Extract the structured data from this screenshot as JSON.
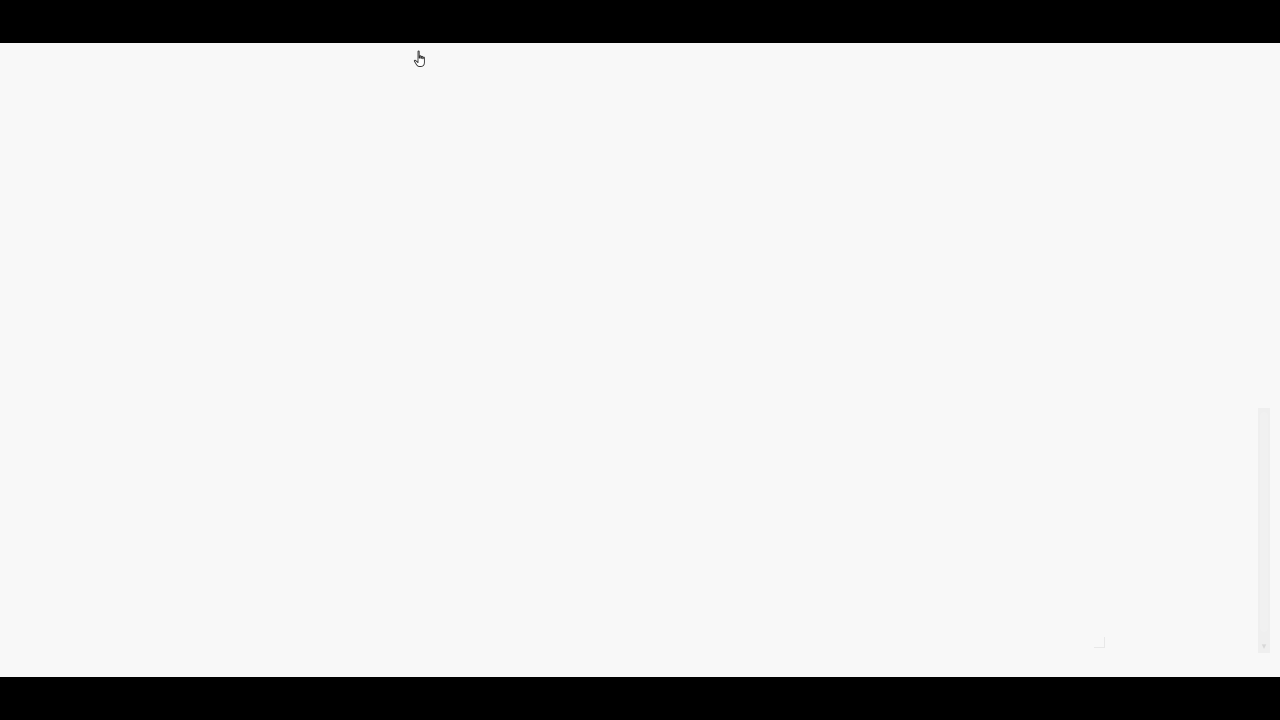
{
  "page": {
    "background_color": "#f8f8f8",
    "letterbox_color": "#000000"
  },
  "cursor": {
    "icon": "hand-pointer-icon"
  },
  "scrollbar": {
    "track_color": "#efefef",
    "arrow_icon": "chevron-down-icon"
  }
}
